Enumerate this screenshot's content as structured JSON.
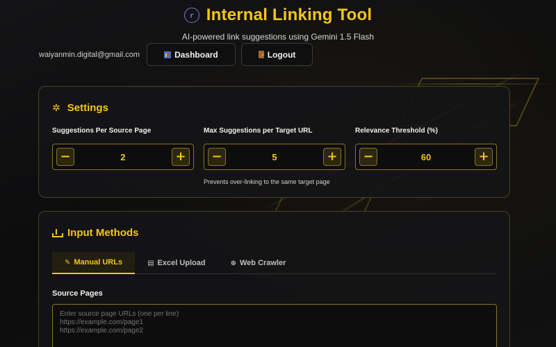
{
  "header": {
    "logo_glyph": "r",
    "title": "Internal Linking Tool",
    "subtitle": "AI-powered link suggestions using Gemini 1.5 Flash"
  },
  "user": {
    "email": "waiyanmin.digital@gmail.com",
    "dashboard_label": "Dashboard",
    "logout_label": "Logout"
  },
  "settings": {
    "title": "Settings",
    "fields": [
      {
        "label": "Suggestions Per Source Page",
        "value": 2,
        "hint": ""
      },
      {
        "label": "Max Suggestions per Target URL",
        "value": 5,
        "hint": "Prevents over-linking to the same target page"
      },
      {
        "label": "Relevance Threshold (%)",
        "value": 60,
        "hint": ""
      }
    ],
    "decrement_glyph": "−",
    "increment_glyph": "+"
  },
  "inputs": {
    "title": "Input Methods",
    "tabs": [
      {
        "label": "Manual URLs",
        "icon": "edit-icon",
        "active": true
      },
      {
        "label": "Excel Upload",
        "icon": "file-icon",
        "active": false
      },
      {
        "label": "Web Crawler",
        "icon": "globe-icon",
        "active": false
      }
    ],
    "source_label": "Source Pages",
    "source_placeholder": "Enter source page URLs (one per line)\nhttps://example.com/page1\nhttps://example.com/page2"
  },
  "colors": {
    "accent": "#f5c518",
    "background": "#0b0b0c",
    "card_border": "#4a4122"
  }
}
